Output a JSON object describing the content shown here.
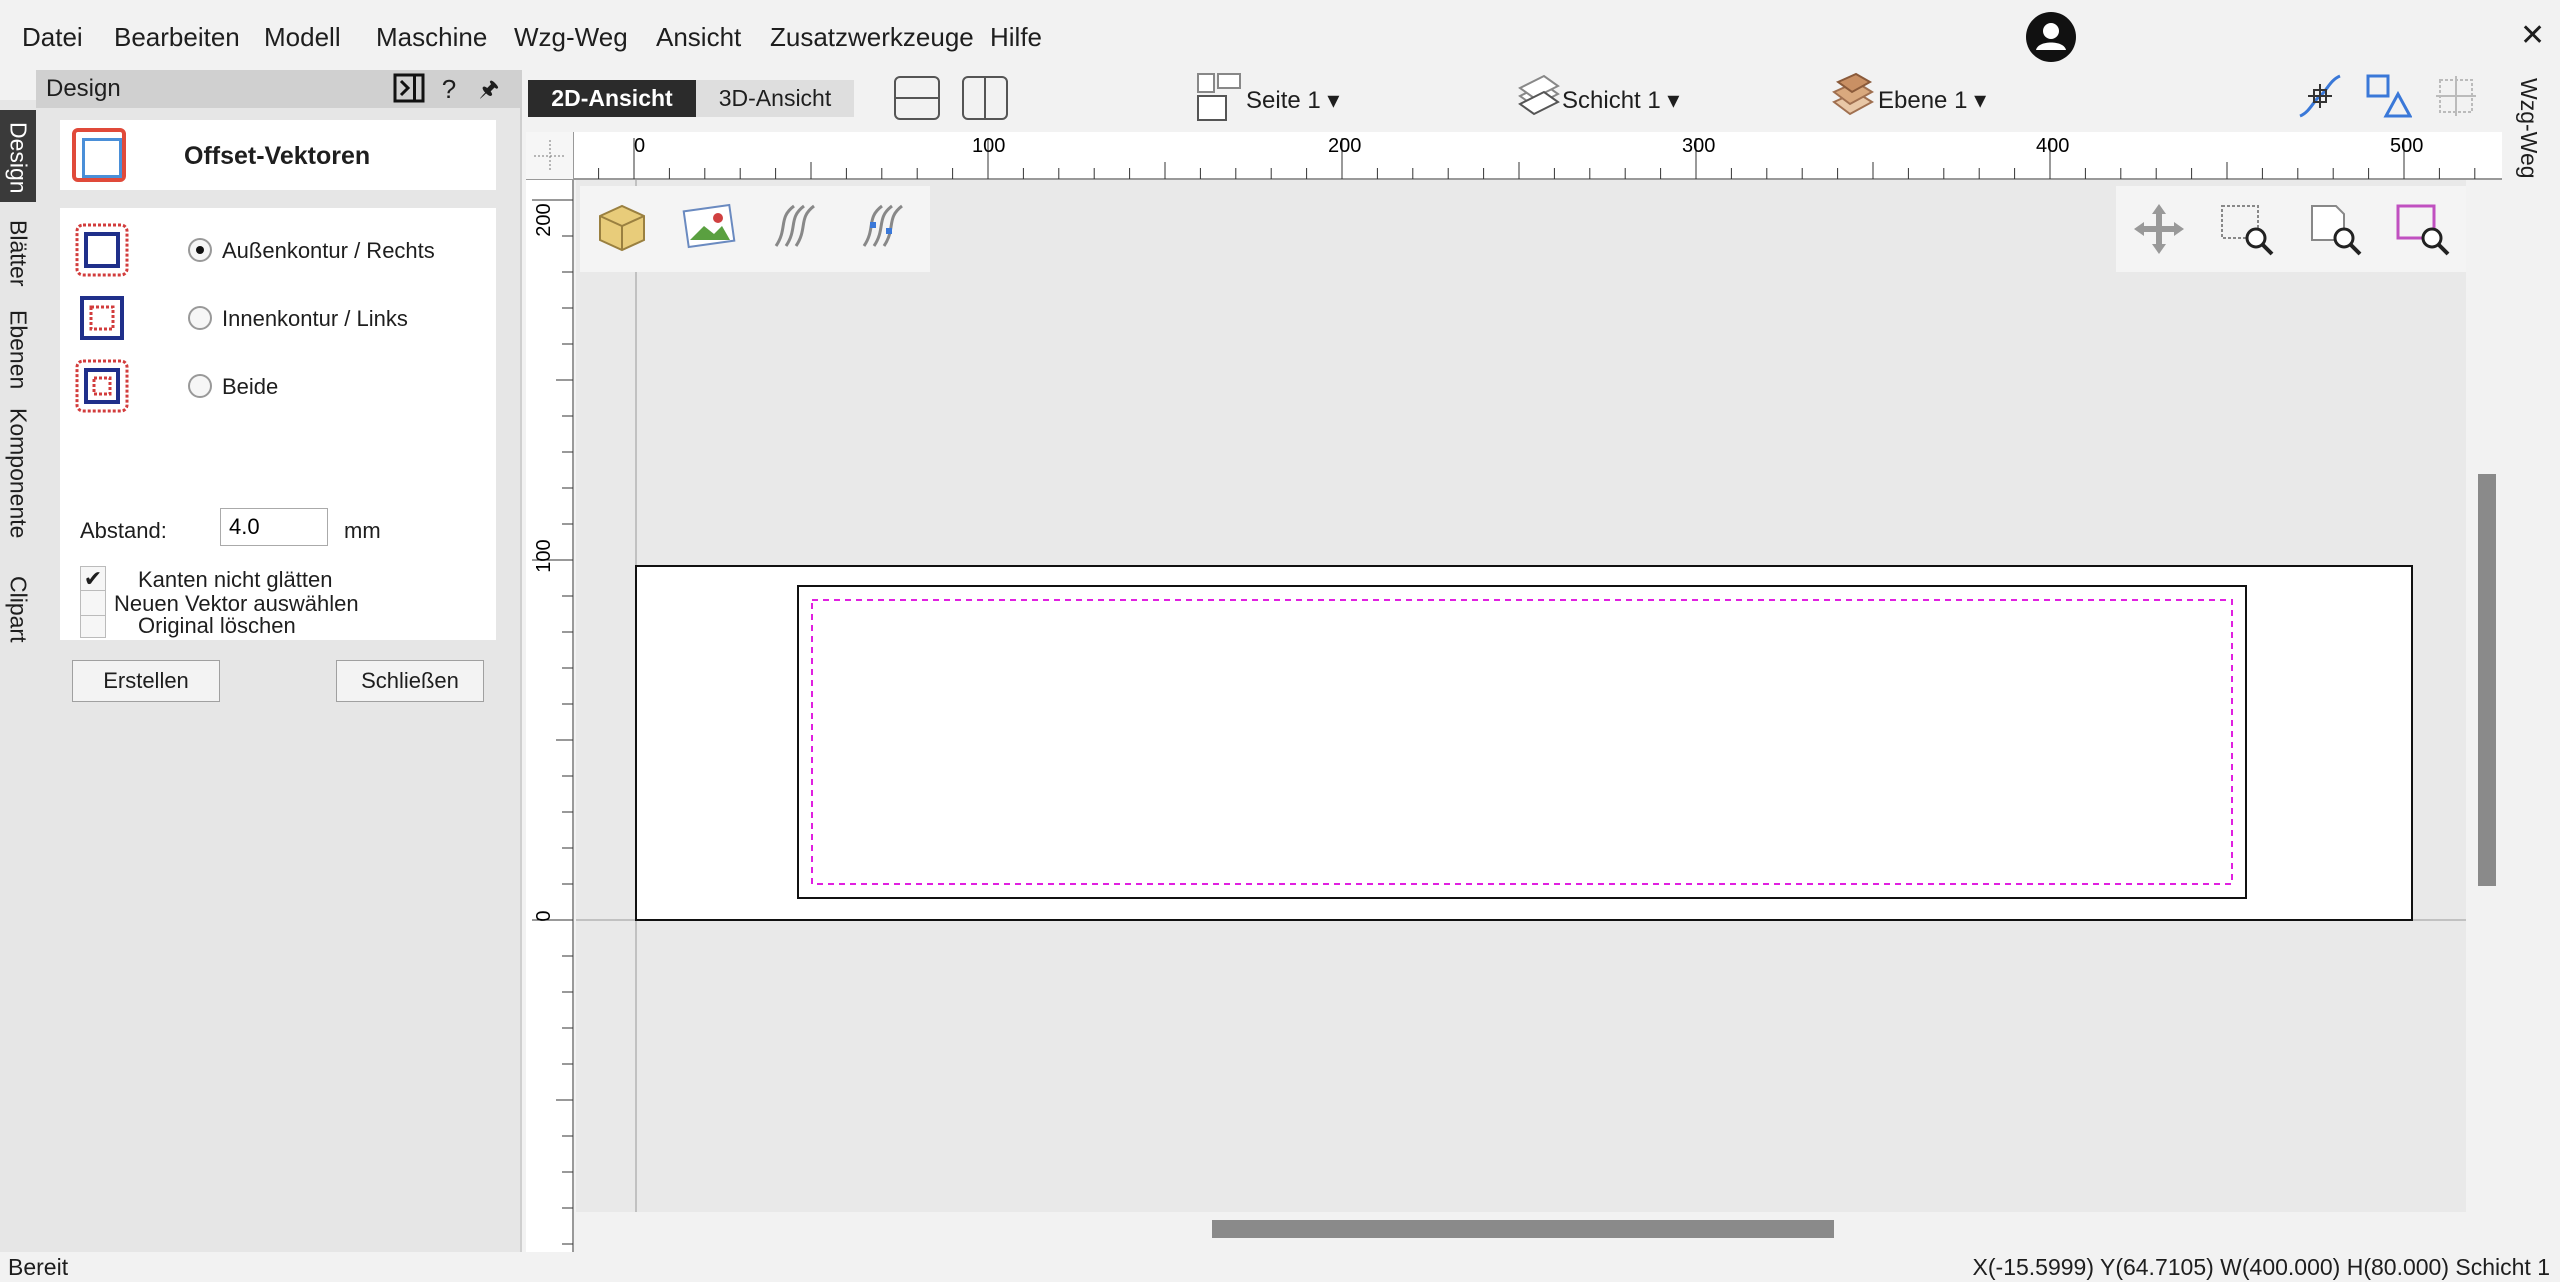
{
  "menu": {
    "items": [
      "Datei",
      "Bearbeiten",
      "Modell",
      "Maschine",
      "Wzg-Weg",
      "Ansicht",
      "Zusatzwerkzeuge",
      "Hilfe"
    ],
    "close_label": "✕"
  },
  "left_tabs": [
    "Design",
    "Blätter",
    "Ebenen",
    "Komponente",
    "Clipart"
  ],
  "panel": {
    "title": "Design",
    "header_icons": {
      "help": "?",
      "pin": "🖈"
    },
    "tool_title": "Offset-Vektoren",
    "options": [
      {
        "label": "Außenkontur / Rechts",
        "checked": true
      },
      {
        "label": "Innenkontur / Links",
        "checked": false
      },
      {
        "label": "Beide",
        "checked": false
      }
    ],
    "abstand": {
      "label": "Abstand:",
      "value": "4.0",
      "unit": "mm"
    },
    "checkboxes": [
      {
        "label": "Kanten nicht glätten",
        "checked": true
      },
      {
        "label": "Original löschen",
        "checked": false
      },
      {
        "label": "Neuen Vektor auswählen",
        "checked": false
      }
    ],
    "buttons": {
      "create": "Erstellen",
      "close": "Schließen"
    }
  },
  "view_toolbar": {
    "tab_2d": "2D-Ansicht",
    "tab_3d": "3D-Ansicht",
    "seite": "Seite 1",
    "schicht": "Schicht 1",
    "ebene": "Ebene 1"
  },
  "right_tab": "Wzg-Weg",
  "rulers": {
    "top_labels": [
      "0",
      "100",
      "200",
      "300",
      "400",
      "500"
    ],
    "left_labels": [
      "200",
      "100",
      "0"
    ]
  },
  "status": {
    "left": "Bereit",
    "right": "X(-15.5999) Y(64.7105)   W(400.000) H(80.000) Schicht 1"
  },
  "colors": {
    "accent_dark": "#2b2b2b",
    "offset_preview": "#e020e0",
    "outline_icon": "#e04a3a"
  }
}
